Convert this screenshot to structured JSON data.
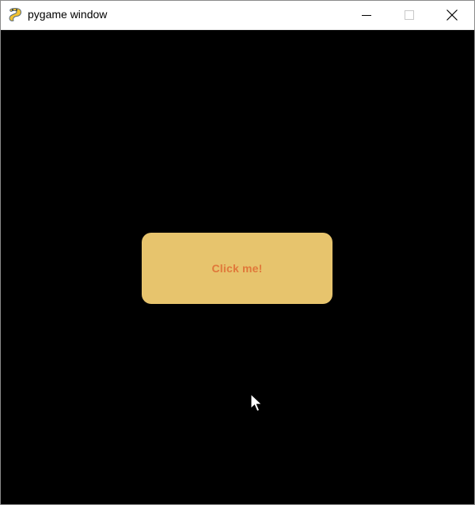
{
  "window": {
    "title": "pygame window",
    "icon": "pygame-snake-icon",
    "controls": {
      "minimize_icon": "minimize-icon",
      "maximize_icon": "maximize-icon",
      "close_icon": "close-icon"
    }
  },
  "game": {
    "background_color": "#000000",
    "button": {
      "label": "Click me!",
      "fill_color": "#e7c46d",
      "text_color": "#e0783a"
    },
    "cursor_icon": "mouse-pointer-icon"
  }
}
